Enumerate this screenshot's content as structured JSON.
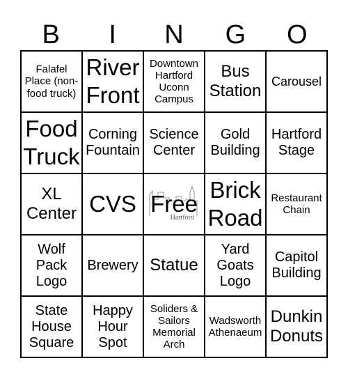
{
  "title_letters": [
    "B",
    "I",
    "N",
    "G",
    "O"
  ],
  "free_cell": {
    "label": "Free",
    "logo_text": "Hartford"
  },
  "cells": [
    "Falafel Place (non-food truck)",
    "River Front",
    "Downtown Hartford Uconn Campus",
    "Bus Station",
    "Carousel",
    "Food Truck",
    "Corning Fountain",
    "Science Center",
    "Gold Building",
    "Hartford Stage",
    "XL Center",
    "CVS",
    "Free",
    "Brick Road",
    "Restaurant Chain",
    "Wolf Pack Logo",
    "Brewery",
    "Statue",
    "Yard Goats Logo",
    "Capitol Building",
    "State House Square",
    "Happy Hour Spot",
    "Soliders & Sailors Memorial Arch",
    "Wadsworth Athenaeum",
    "Dunkin Donuts"
  ]
}
